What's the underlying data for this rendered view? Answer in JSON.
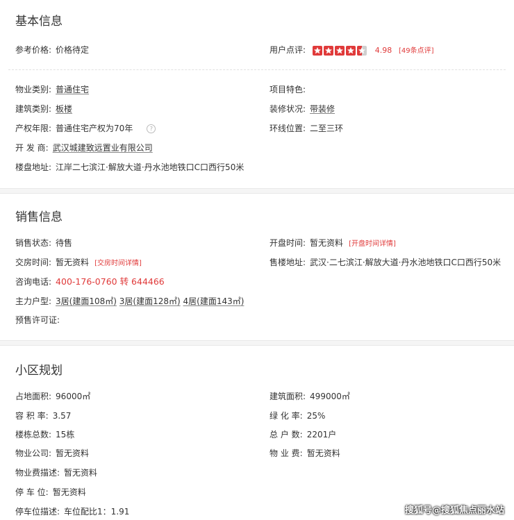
{
  "basic": {
    "title": "基本信息",
    "ref_price_label": "参考价格:",
    "ref_price_value": "价格待定",
    "rating_label": "用户点评:",
    "rating_value": "4.98",
    "rating_count": "[49条点评]",
    "rating_stars": 4.5,
    "property_type_label": "物业类别:",
    "property_type_value": "普通住宅",
    "feature_label": "项目特色:",
    "feature_value": "",
    "building_type_label": "建筑类别:",
    "building_type_value": "板楼",
    "decoration_label": "装修状况:",
    "decoration_value": "带装修",
    "tenure_label": "产权年限:",
    "tenure_value": "普通住宅产权为70年",
    "ring_label": "环线位置:",
    "ring_value": "二至三环",
    "developer_label": "开 发 商:",
    "developer_value": "武汉城建致远置业有限公司",
    "address_label": "楼盘地址:",
    "address_value": "江岸二七滨江·解放大道·丹水池地铁口C口西行50米"
  },
  "sales": {
    "title": "销售信息",
    "status_label": "销售状态:",
    "status_value": "待售",
    "open_label": "开盘时间:",
    "open_value": "暂无资料",
    "open_link": "[开盘时间详情]",
    "delivery_label": "交房时间:",
    "delivery_value": "暂无资料",
    "delivery_link": "[交房时间详情]",
    "office_label": "售楼地址:",
    "office_value": "武汉·二七滨江·解放大道·丹水池地铁口C口西行50米",
    "phone_label": "咨询电话:",
    "phone_value": "400-176-0760 转 644466",
    "units_label": "主力户型:",
    "units": [
      "3居(建面108㎡)",
      "3居(建面128㎡)",
      "4居(建面143㎡)"
    ],
    "permit_label": "预售许可证:",
    "permit_value": ""
  },
  "plan": {
    "title": "小区规划",
    "land_area_label": "占地面积:",
    "land_area_value": "96000㎡",
    "build_area_label": "建筑面积:",
    "build_area_value": "499000㎡",
    "far_label": "容 积 率:",
    "far_value": "3.57",
    "green_label": "绿 化 率:",
    "green_value": "25%",
    "buildings_label": "楼栋总数:",
    "buildings_value": "15栋",
    "households_label": "总 户 数:",
    "households_value": "2201户",
    "pm_company_label": "物业公司:",
    "pm_company_value": "暂无资料",
    "pm_fee_label": "物 业 费:",
    "pm_fee_value": "暂无资料",
    "pm_fee_desc_label": "物业费描述:",
    "pm_fee_desc_value": "暂无资料",
    "parking_label": "停 车 位:",
    "parking_value": "暂无资料",
    "parking_desc_label": "停车位描述:",
    "parking_desc_value": "车位配比1：1.91"
  },
  "watermark": "搜狐号@搜狐焦点丽水站",
  "colors": {
    "accent": "#e03a3a",
    "text": "#333333"
  }
}
